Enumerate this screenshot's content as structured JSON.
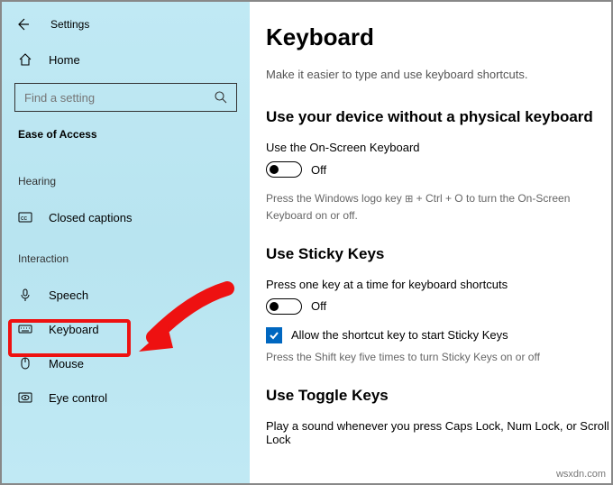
{
  "header": {
    "title": "Settings"
  },
  "sidebar": {
    "home": "Home",
    "search_placeholder": "Find a setting",
    "section": "Ease of Access",
    "groups": {
      "hearing": {
        "title": "Hearing",
        "items": [
          {
            "label": "Closed captions"
          }
        ]
      },
      "interaction": {
        "title": "Interaction",
        "items": [
          {
            "label": "Speech"
          },
          {
            "label": "Keyboard"
          },
          {
            "label": "Mouse"
          },
          {
            "label": "Eye control"
          }
        ]
      }
    }
  },
  "main": {
    "title": "Keyboard",
    "subtitle": "Make it easier to type and use keyboard shortcuts.",
    "sec1": {
      "heading": "Use your device without a physical keyboard",
      "toggle_label": "Use the On-Screen Keyboard",
      "toggle_state": "Off",
      "hint_a": "Press the Windows logo key ",
      "hint_b": " + Ctrl + O to turn the On-Screen Keyboard on or off."
    },
    "sec2": {
      "heading": "Use Sticky Keys",
      "toggle_label": "Press one key at a time for keyboard shortcuts",
      "toggle_state": "Off",
      "chk_label": "Allow the shortcut key to start Sticky Keys",
      "chk_hint": "Press the Shift key five times to turn Sticky Keys on or off"
    },
    "sec3": {
      "heading": "Use Toggle Keys",
      "desc": "Play a sound whenever you press Caps Lock, Num Lock, or Scroll Lock"
    }
  },
  "watermark": "wsxdn.com"
}
